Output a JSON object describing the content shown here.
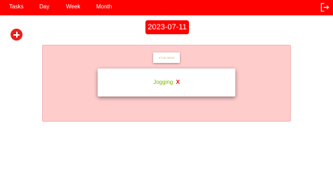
{
  "nav": {
    "items": [
      {
        "label": "Tasks"
      },
      {
        "label": "Day"
      },
      {
        "label": "Week"
      },
      {
        "label": "Month"
      }
    ],
    "logout_icon": "logout-icon"
  },
  "add_icon": "plus-circle-icon",
  "date": "2023-07-11",
  "slot": {
    "time": "07:00–08:00",
    "task": {
      "title": "Jogging",
      "delete_label": "X"
    }
  },
  "colors": {
    "accent": "#ff0000",
    "panel": "#ffcccc",
    "task_text": "#7fb800",
    "time_text": "#b7b34a"
  }
}
